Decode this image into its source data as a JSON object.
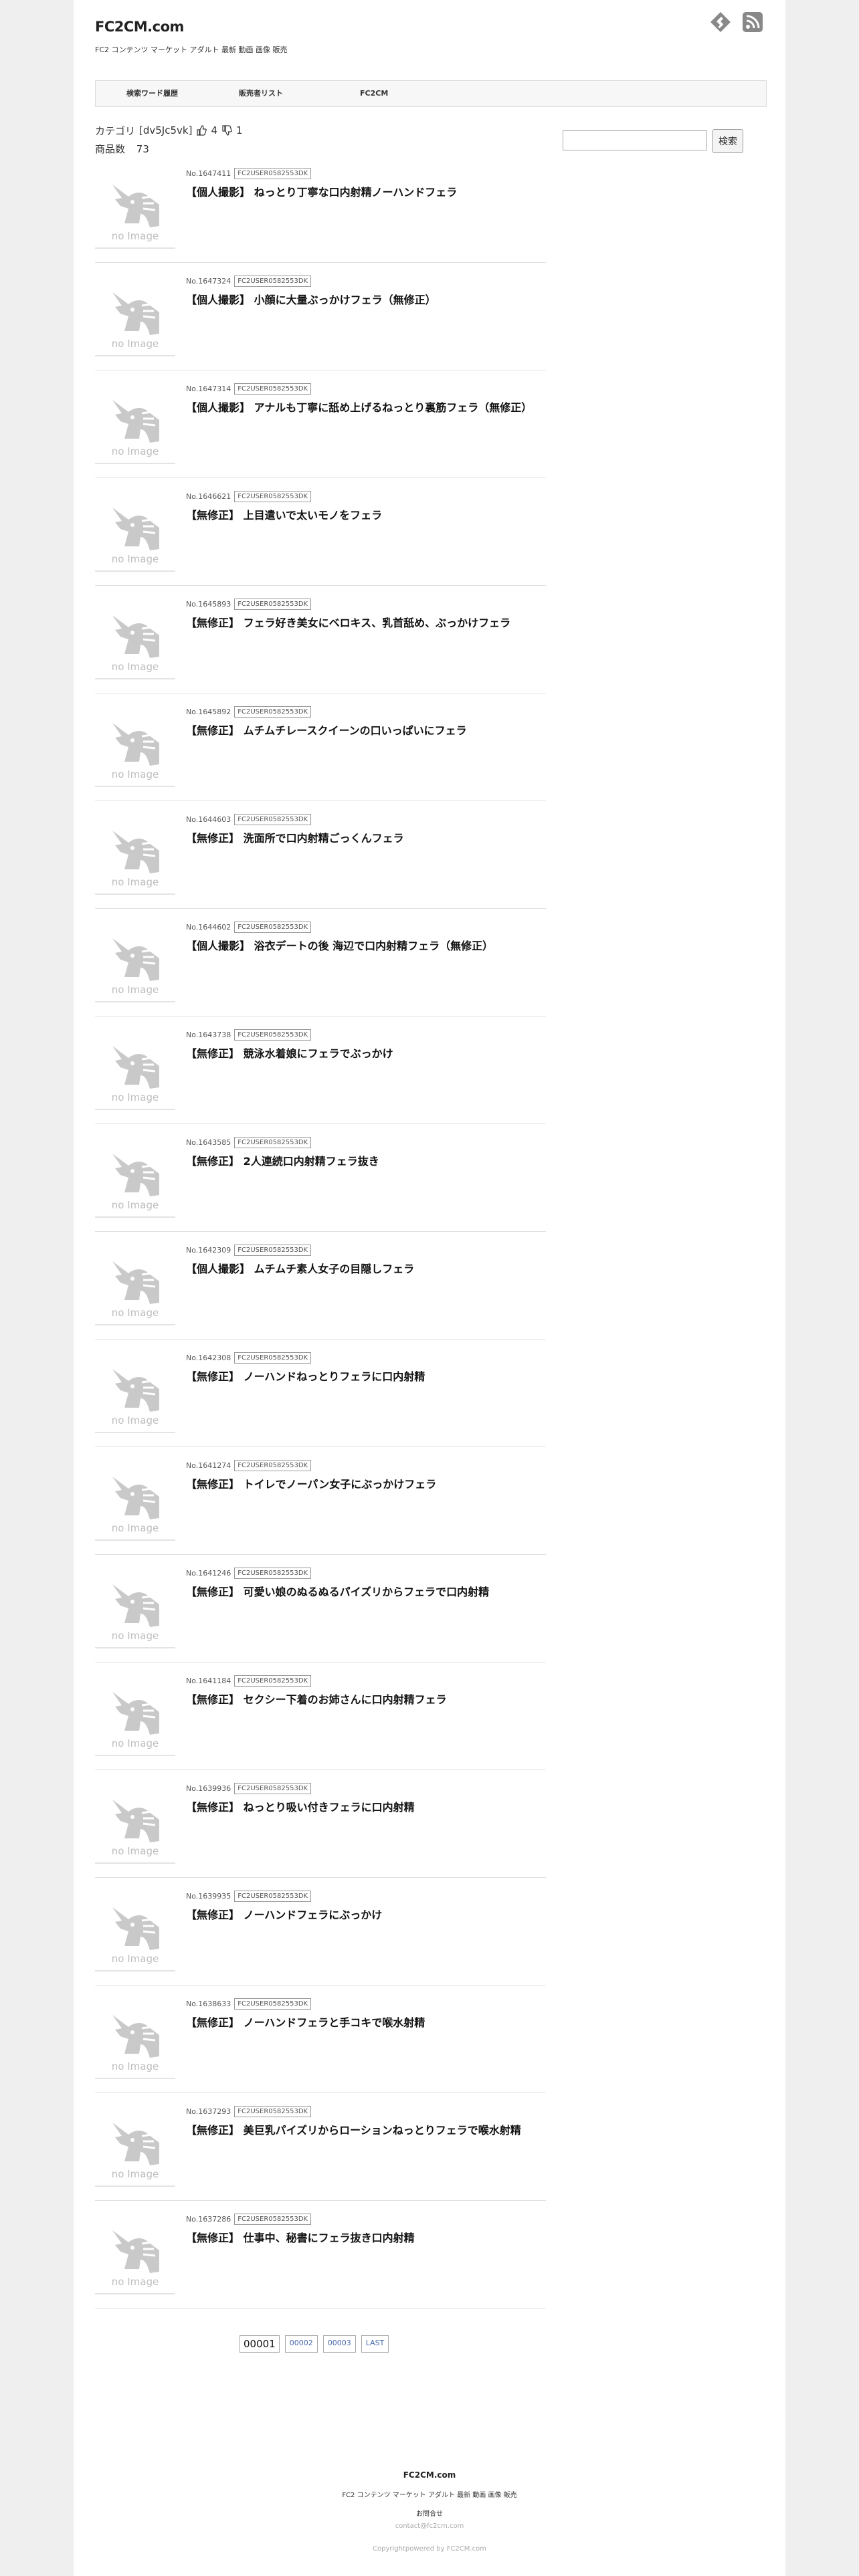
{
  "header": {
    "site_title": "FC2CM.com",
    "site_desc": "FC2 コンテンツ マーケット アダルト 最新 動画 画像 販売",
    "icons": [
      "feedly-icon",
      "rss-icon"
    ]
  },
  "nav": {
    "items": [
      "検索ワード履歴",
      "販売者リスト",
      "FC2CM"
    ]
  },
  "category": {
    "label": "カテゴリ",
    "id": "[dv5Jc5vk]",
    "likes": "4",
    "dislikes": "1",
    "count_label": "商品数",
    "count": "73"
  },
  "search": {
    "placeholder": "",
    "button": "検索"
  },
  "no_image": "no Image",
  "items": [
    {
      "no": "No.1647411",
      "seller": "FC2USER0582553DK",
      "title": "【個人撮影】 ねっとり丁寧な口内射精ノーハンドフェラ"
    },
    {
      "no": "No.1647324",
      "seller": "FC2USER0582553DK",
      "title": "【個人撮影】 小顔に大量ぶっかけフェラ（無修正）"
    },
    {
      "no": "No.1647314",
      "seller": "FC2USER0582553DK",
      "title": "【個人撮影】 アナルも丁寧に舐め上げるねっとり裏筋フェラ（無修正）"
    },
    {
      "no": "No.1646621",
      "seller": "FC2USER0582553DK",
      "title": "【無修正】 上目遣いで太いモノをフェラ"
    },
    {
      "no": "No.1645893",
      "seller": "FC2USER0582553DK",
      "title": "【無修正】 フェラ好き美女にベロキス、乳首舐め、ぶっかけフェラ"
    },
    {
      "no": "No.1645892",
      "seller": "FC2USER0582553DK",
      "title": "【無修正】 ムチムチレースクイーンの口いっぱいにフェラ"
    },
    {
      "no": "No.1644603",
      "seller": "FC2USER0582553DK",
      "title": "【無修正】 洗面所で口内射精ごっくんフェラ"
    },
    {
      "no": "No.1644602",
      "seller": "FC2USER0582553DK",
      "title": "【個人撮影】 浴衣デートの後 海辺で口内射精フェラ（無修正）"
    },
    {
      "no": "No.1643738",
      "seller": "FC2USER0582553DK",
      "title": "【無修正】 競泳水着娘にフェラでぶっかけ"
    },
    {
      "no": "No.1643585",
      "seller": "FC2USER0582553DK",
      "title": "【無修正】 2人連続口内射精フェラ抜き"
    },
    {
      "no": "No.1642309",
      "seller": "FC2USER0582553DK",
      "title": "【個人撮影】 ムチムチ素人女子の目隠しフェラ"
    },
    {
      "no": "No.1642308",
      "seller": "FC2USER0582553DK",
      "title": "【無修正】 ノーハンドねっとりフェラに口内射精"
    },
    {
      "no": "No.1641274",
      "seller": "FC2USER0582553DK",
      "title": "【無修正】 トイレでノーパン女子にぶっかけフェラ"
    },
    {
      "no": "No.1641246",
      "seller": "FC2USER0582553DK",
      "title": "【無修正】 可愛い娘のぬるぬるパイズリからフェラで口内射精"
    },
    {
      "no": "No.1641184",
      "seller": "FC2USER0582553DK",
      "title": "【無修正】 セクシー下着のお姉さんに口内射精フェラ"
    },
    {
      "no": "No.1639936",
      "seller": "FC2USER0582553DK",
      "title": "【無修正】 ねっとり吸い付きフェラに口内射精"
    },
    {
      "no": "No.1639935",
      "seller": "FC2USER0582553DK",
      "title": "【無修正】 ノーハンドフェラにぶっかけ"
    },
    {
      "no": "No.1638633",
      "seller": "FC2USER0582553DK",
      "title": "【無修正】 ノーハンドフェラと手コキで喉水射精"
    },
    {
      "no": "No.1637293",
      "seller": "FC2USER0582553DK",
      "title": "【無修正】 美巨乳パイズリからローションねっとりフェラで喉水射精"
    },
    {
      "no": "No.1637286",
      "seller": "FC2USER0582553DK",
      "title": "【無修正】 仕事中、秘書にフェラ抜き口内射精"
    }
  ],
  "pager": [
    "00001",
    "00002",
    "00003",
    "LAST"
  ],
  "footer": {
    "site": "FC2CM.com",
    "desc": "FC2 コンテンツ マーケット アダルト 最新 動画 画像 販売",
    "contact_label": "お問合せ",
    "email": "contact@fc2cm.com",
    "copyright": "Copyrightpowered by FC2CM.com"
  }
}
